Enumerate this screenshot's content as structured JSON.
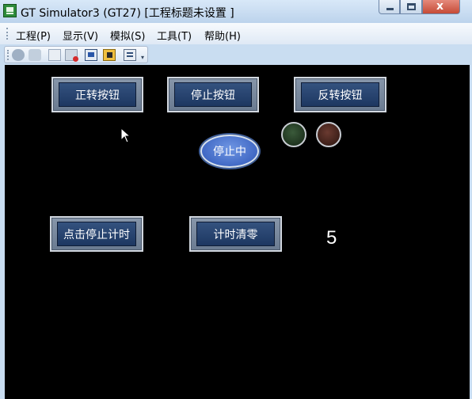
{
  "window": {
    "title": "GT Simulator3 (GT27)  [工程标题未设置 ]",
    "controls": {
      "minimize_icon": "minimize-icon",
      "maximize_icon": "maximize-icon",
      "close_icon": "close-icon",
      "close_glyph": "x"
    }
  },
  "menu": {
    "items": [
      "工程(P)",
      "显示(V)",
      "模拟(S)",
      "工具(T)",
      "帮助(H)"
    ]
  },
  "toolbar": {
    "tools": [
      "reload-icon",
      "open-icon",
      "page-icon",
      "stop-icon",
      "monitor-icon",
      "camera-icon",
      "settings-icon"
    ]
  },
  "screen": {
    "buttons": {
      "forward": "正转按钮",
      "stop": "停止按钮",
      "reverse": "反转按钮",
      "stop_timer": "点击停止计时",
      "clear_timer": "计时清零"
    },
    "status": "停止中",
    "lamps": {
      "forward_color": "#2f4f2f",
      "reverse_color": "#5a2e26"
    },
    "counter": "5",
    "colors": {
      "background": "#000000",
      "button_face": "#2a4570",
      "status_oval": "#4a74d0"
    }
  }
}
